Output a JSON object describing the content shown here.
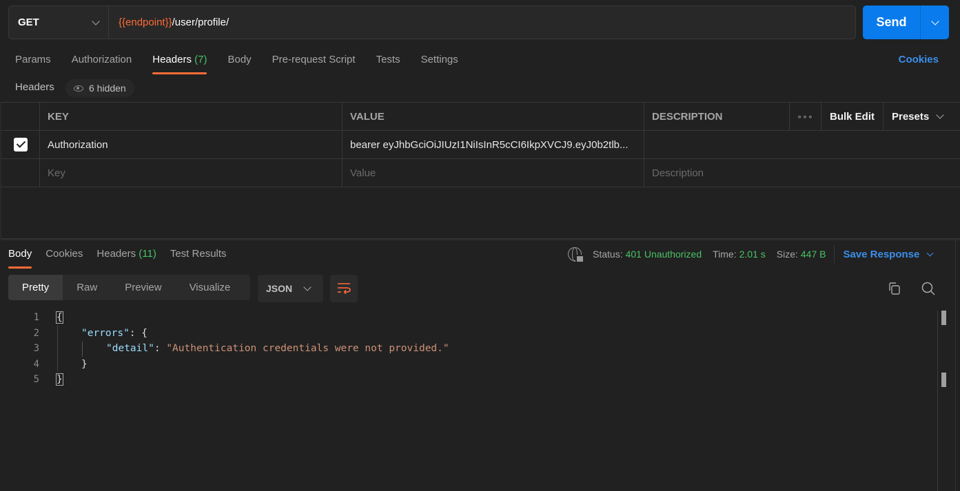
{
  "request": {
    "method": "GET",
    "url_variable": "{{endpoint}}",
    "url_path": "/user/profile/",
    "send_label": "Send"
  },
  "request_tabs": [
    {
      "label": "Params"
    },
    {
      "label": "Authorization"
    },
    {
      "label": "Headers",
      "count": "(7)",
      "active": true
    },
    {
      "label": "Body"
    },
    {
      "label": "Pre-request Script"
    },
    {
      "label": "Tests"
    },
    {
      "label": "Settings"
    }
  ],
  "cookies_link": "Cookies",
  "headers_section": {
    "title": "Headers",
    "hidden_label": "6 hidden",
    "columns": {
      "key": "KEY",
      "value": "VALUE",
      "description": "DESCRIPTION"
    },
    "more_icon": "•••",
    "bulk_edit": "Bulk Edit",
    "presets": "Presets",
    "rows": [
      {
        "checked": true,
        "key": "Authorization",
        "value": "bearer eyJhbGciOiJIUzI1NiIsInR5cCI6IkpXVCJ9.eyJ0b2tlb...",
        "description": ""
      }
    ],
    "placeholders": {
      "key": "Key",
      "value": "Value",
      "description": "Description"
    }
  },
  "response": {
    "tabs": [
      {
        "label": "Body",
        "active": true
      },
      {
        "label": "Cookies"
      },
      {
        "label": "Headers",
        "count": "(11)"
      },
      {
        "label": "Test Results"
      }
    ],
    "status_label": "Status:",
    "status_value": "401 Unauthorized",
    "time_label": "Time:",
    "time_value": "2.01 s",
    "size_label": "Size:",
    "size_value": "447 B",
    "save_response": "Save Response",
    "formats": [
      "Pretty",
      "Raw",
      "Preview",
      "Visualize"
    ],
    "language": "JSON",
    "body_lines": [
      {
        "n": "1"
      },
      {
        "n": "2",
        "key": "\"errors\""
      },
      {
        "n": "3",
        "key": "\"detail\"",
        "value": "\"Authentication credentials were not provided.\""
      },
      {
        "n": "4"
      },
      {
        "n": "5"
      }
    ]
  },
  "colors": {
    "accent": "#ff6c37",
    "primary": "#097bed",
    "link": "#3b8eea",
    "success": "#49c266",
    "background": "#212121"
  }
}
